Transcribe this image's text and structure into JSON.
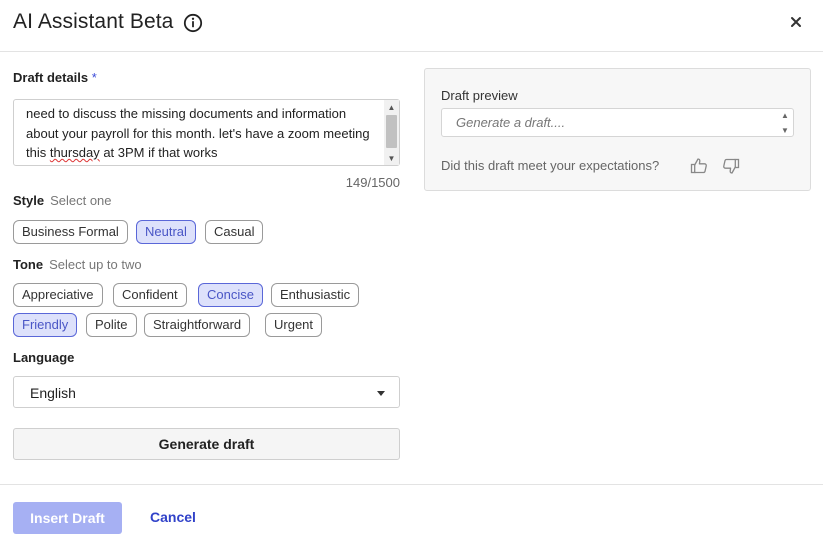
{
  "header": {
    "title": "AI Assistant Beta",
    "info_icon": "info-circle-icon",
    "close_icon": "close-icon"
  },
  "draft_details": {
    "label": "Draft details",
    "required_marker": "*",
    "text_before": "need to discuss the missing documents and information about your payroll for this month. let's have a zoom meeting this ",
    "misspelled_word": "thursday",
    "text_after": " at 3PM if that works",
    "counter": "149/1500"
  },
  "style": {
    "label": "Style",
    "hint": "Select one",
    "options": [
      {
        "label": "Business Formal",
        "selected": false
      },
      {
        "label": "Neutral",
        "selected": true
      },
      {
        "label": "Casual",
        "selected": false
      }
    ]
  },
  "tone": {
    "label": "Tone",
    "hint": "Select up to two",
    "options": [
      {
        "label": "Appreciative",
        "selected": false
      },
      {
        "label": "Confident",
        "selected": false
      },
      {
        "label": "Concise",
        "selected": true
      },
      {
        "label": "Enthusiastic",
        "selected": false
      },
      {
        "label": "Friendly",
        "selected": true
      },
      {
        "label": "Polite",
        "selected": false
      },
      {
        "label": "Straightforward",
        "selected": false
      },
      {
        "label": "Urgent",
        "selected": false
      }
    ]
  },
  "language": {
    "label": "Language",
    "selected": "English"
  },
  "generate_button": "Generate draft",
  "preview": {
    "label": "Draft preview",
    "placeholder": "Generate a draft....",
    "feedback_question": "Did this draft meet your expectations?",
    "thumbs_up_icon": "thumbs-up-icon",
    "thumbs_down_icon": "thumbs-down-icon"
  },
  "footer": {
    "insert_label": "Insert Draft",
    "cancel_label": "Cancel"
  },
  "colors": {
    "accent": "#3142c9",
    "chip_selected_bg": "#dde1fb",
    "chip_selected_border": "#5a67d8",
    "insert_disabled_bg": "#a6b0f3",
    "required_marker": "#3b4bd8"
  }
}
